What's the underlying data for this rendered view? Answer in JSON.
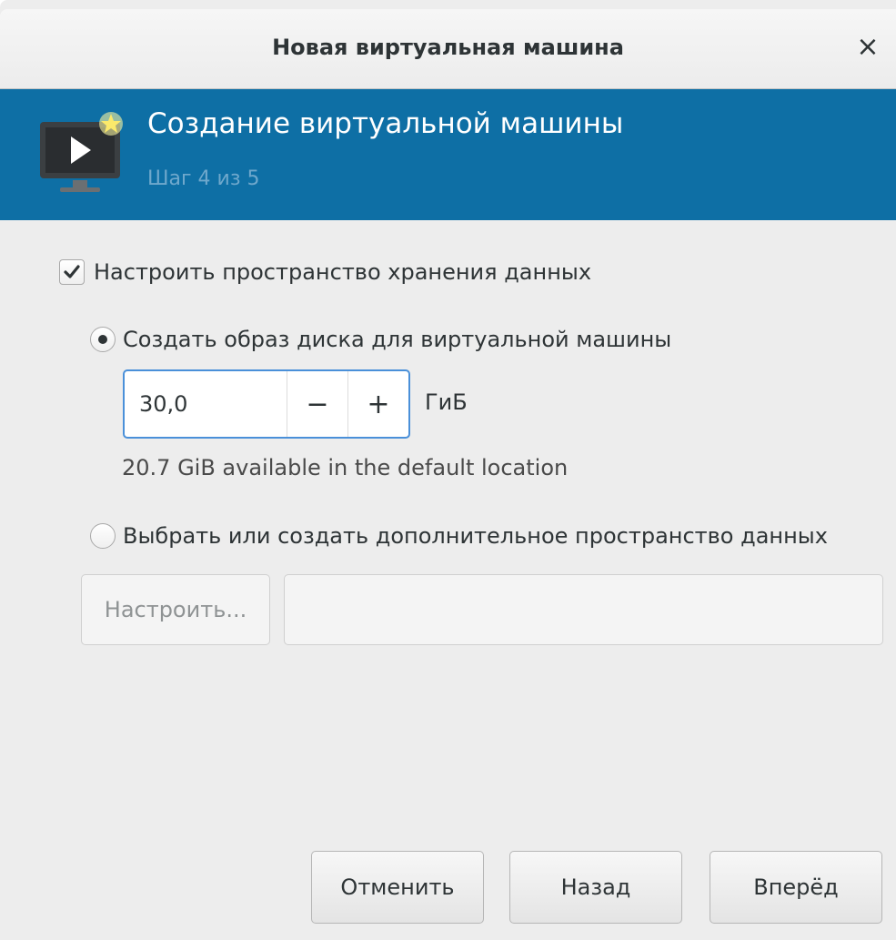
{
  "window": {
    "title": "Новая виртуальная машина",
    "close_glyph": "×"
  },
  "banner": {
    "heading": "Создание виртуальной машины",
    "step": "Шаг 4 из 5",
    "background": "#0e6fa5",
    "icon": "vm-monitor-star-icon"
  },
  "storage": {
    "enable_label": "Настроить пространство хранения данных",
    "enable_checked": true,
    "create_disk_label": "Создать образ диска для виртуальной машины",
    "create_disk_selected": true,
    "size_value": "30,0",
    "decrement_glyph": "−",
    "increment_glyph": "+",
    "unit": "ГиБ",
    "available_text": "20.7 GiB available in the default location",
    "custom_label": "Выбрать или создать дополнительное пространство данных",
    "custom_selected": false,
    "configure_label": "Настроить...",
    "path_value": ""
  },
  "footer": {
    "cancel_label": "Отменить",
    "back_label": "Назад",
    "forward_label": "Вперёд"
  },
  "colors": {
    "accent": "#4a90d9",
    "dialog_bg": "#ededed"
  }
}
